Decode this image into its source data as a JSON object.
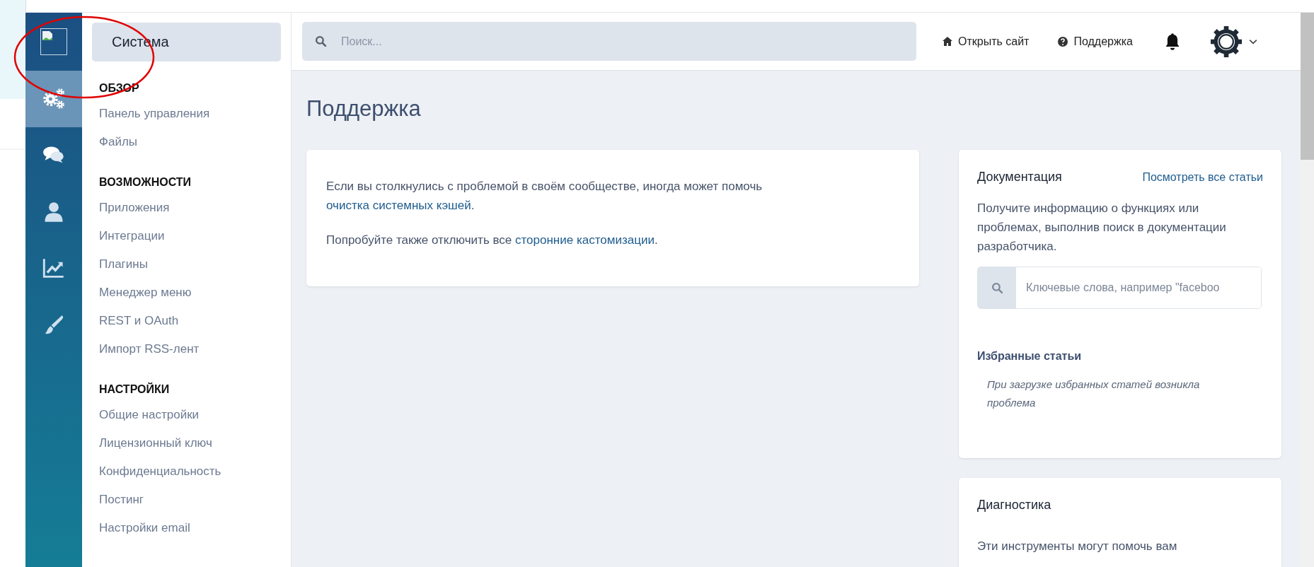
{
  "rail": {
    "items": [
      {
        "kind": "gears",
        "selected": true
      },
      {
        "kind": "chat",
        "selected": false
      },
      {
        "kind": "user",
        "selected": false
      },
      {
        "kind": "chart",
        "selected": false
      },
      {
        "kind": "brush",
        "selected": false
      }
    ]
  },
  "sidebar": {
    "title": "Система",
    "sections": [
      {
        "heading": "ОБЗОР",
        "items": [
          "Панель управления",
          "Файлы"
        ]
      },
      {
        "heading": "ВОЗМОЖНОСТИ",
        "items": [
          "Приложения",
          "Интеграции",
          "Плагины",
          "Менеджер меню",
          "REST и OAuth",
          "Импорт RSS-лент"
        ]
      },
      {
        "heading": "НАСТРОЙКИ",
        "items": [
          "Общие настройки",
          "Лицензионный ключ",
          "Конфиденциальность",
          "Постинг",
          "Настройки email"
        ]
      }
    ]
  },
  "topbar": {
    "search": {
      "placeholder": "Поиск..."
    },
    "links": [
      {
        "kind": "home",
        "label": "Открыть сайт"
      },
      {
        "kind": "help",
        "label": "Поддержка"
      }
    ]
  },
  "page": {
    "title": "Поддержка",
    "notice": [
      [
        {
          "kind": "text",
          "text": "Если вы столкнулись с проблемой в своём сообществе, иногда может помочь"
        },
        {
          "kind": "link",
          "text": "очистка системных кэшей"
        },
        {
          "kind": "text",
          "text": "."
        }
      ],
      [
        {
          "kind": "text",
          "text": "Попробуйте также отключить все"
        },
        {
          "kind": "link",
          "text": "сторонние кастомизации"
        },
        {
          "kind": "text",
          "text": "."
        }
      ]
    ],
    "documentation": {
      "title": "Документация",
      "link": "Посмотреть все статьи",
      "text": "Получите информацию о функциях или проблемах, выполнив поиск в документации разработчика.",
      "search": {
        "placeholder": "Ключевые слова, например \"faceboo"
      },
      "featured_title": "Избранные статьи",
      "featured_error": "При загрузке избранных статей возникла проблема"
    },
    "diagnostics": {
      "title": "Диагностика",
      "text": "Эти инструменты могут помочь вам"
    }
  }
}
